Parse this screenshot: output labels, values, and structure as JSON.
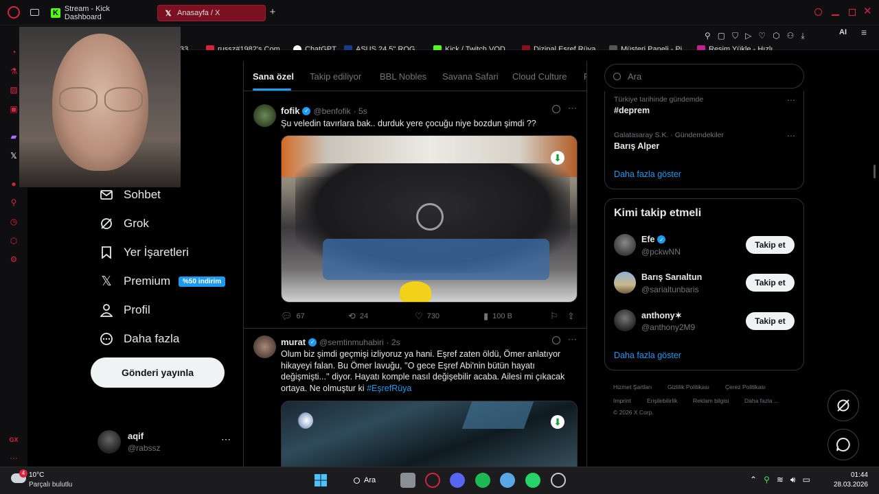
{
  "browser": {
    "tabs": [
      {
        "label": "Stream - Kick Dashboard",
        "active": false
      },
      {
        "label": "Anasayfa / X",
        "active": true
      }
    ],
    "bookmarks": [
      {
        "label": "33..."
      },
      {
        "label": "russz#1982's Com..."
      },
      {
        "label": "ChatGPT"
      },
      {
        "label": "ASUS 24,5\" ROG..."
      },
      {
        "label": "Kick / Twitch VOD..."
      },
      {
        "label": "Dizipal Eşref Rüya..."
      },
      {
        "label": "Müşteri Paneli - Pi..."
      },
      {
        "label": "Resim Yükle - Hızlı..."
      }
    ],
    "toolbar_ai": "AI",
    "accent": "#d9233e"
  },
  "left_nav": {
    "items": [
      {
        "label": "Sohbet",
        "icon": "mail-icon"
      },
      {
        "label": "Grok",
        "icon": "grok-icon"
      },
      {
        "label": "Yer İşaretleri",
        "icon": "bookmark-icon"
      },
      {
        "label": "Premium",
        "icon": "x-logo-icon",
        "badge": "%50 indirim"
      },
      {
        "label": "Profil",
        "icon": "person-icon"
      },
      {
        "label": "Daha fazla",
        "icon": "more-circle-icon"
      }
    ],
    "post_button": "Gönderi yayınla",
    "account": {
      "name": "aqif",
      "handle": "@rabssz"
    }
  },
  "feed": {
    "tabs": [
      "Sana özel",
      "Takip ediliyor",
      "BBL Nobles",
      "Savana Safari",
      "Cloud Culture",
      "F"
    ],
    "active_tab": "Sana özel",
    "posts": [
      {
        "name": "fofik",
        "handle": "@benfofik",
        "time": "· 5s",
        "text": "Şu veledin tavırlara bak.. durduk yere çocuğu niye bozdun şimdi ??",
        "replies": "67",
        "reposts": "24",
        "likes": "730",
        "views": "100 B"
      },
      {
        "name": "murat",
        "handle": "@semtinmuhabiri",
        "time": "· 2s",
        "text": "Olum biz şimdi geçmişi izliyoruz ya hani. Eşref zaten öldü, Ömer anlatıyor hikayeyi falan. Bu Ömer lavuğu, ''O gece Eşref Abi'nin bütün hayatı değişmişti...'' diyor. Hayatı komple nasıl değişebilir acaba. Ailesi mi çıkacak ortaya. Ne olmuştur ki",
        "hashtag": "#EşrefRüya"
      }
    ]
  },
  "right": {
    "search_placeholder": "Ara",
    "trends": [
      {
        "context": "Türkiye tarihinde gündemde",
        "title": "#deprem"
      },
      {
        "context": "Galatasaray S.K. · Gündemdekiler",
        "title": "Barış Alper"
      }
    ],
    "trends_more": "Daha fazla göster",
    "who_to_follow_title": "Kimi takip etmeli",
    "suggestions": [
      {
        "name": "Efe",
        "handle": "@pckwNN",
        "verified": true,
        "button": "Takip et"
      },
      {
        "name": "Barış Sarıaltun",
        "handle": "@sarialtunbaris",
        "verified": false,
        "button": "Takip et"
      },
      {
        "name": "anthony✶",
        "handle": "@anthony2M9",
        "verified": false,
        "button": "Takip et"
      }
    ],
    "follow_more": "Daha fazla göster",
    "footer_links": [
      "Hizmet Şartları",
      "Gizlilik Politikası",
      "Çerez Politikası",
      "Imprint",
      "Erişilebilirlik",
      "Reklam bilgisi",
      "Daha fazla ..."
    ],
    "copyright": "© 2026 X Corp."
  },
  "taskbar": {
    "weather_temp": "10°C",
    "weather_desc": "Parçalı bulutlu",
    "weather_badge": "4",
    "search_label": "Ara",
    "time": "01:44",
    "date": "28.03.2026"
  }
}
